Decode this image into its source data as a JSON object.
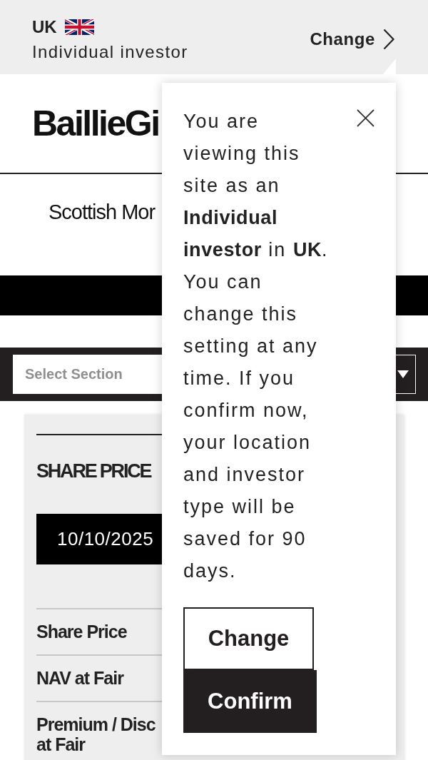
{
  "location_bar": {
    "country": "UK",
    "investor_type": "Individual investor",
    "change_link": "Change"
  },
  "header": {
    "logo_text": "BaillieGi"
  },
  "fund_name": "Scottish Mor",
  "section_selector": {
    "placeholder": "Select Section"
  },
  "share_price_panel": {
    "title": "SHARE PRICE",
    "date": "10/10/2025",
    "rows": [
      "Share Price",
      "NAV at Fair",
      "Premium / Disc at Fair"
    ]
  },
  "popover": {
    "message": "You are viewing this site as an **Individual investor** in **UK**. You can change this setting at any time. If you confirm now, your location and investor type will be saved for 90 days.",
    "buttons": [
      {
        "label": "Change",
        "kind": "outline"
      },
      {
        "label": "Confirm",
        "kind": "filled"
      }
    ]
  }
}
